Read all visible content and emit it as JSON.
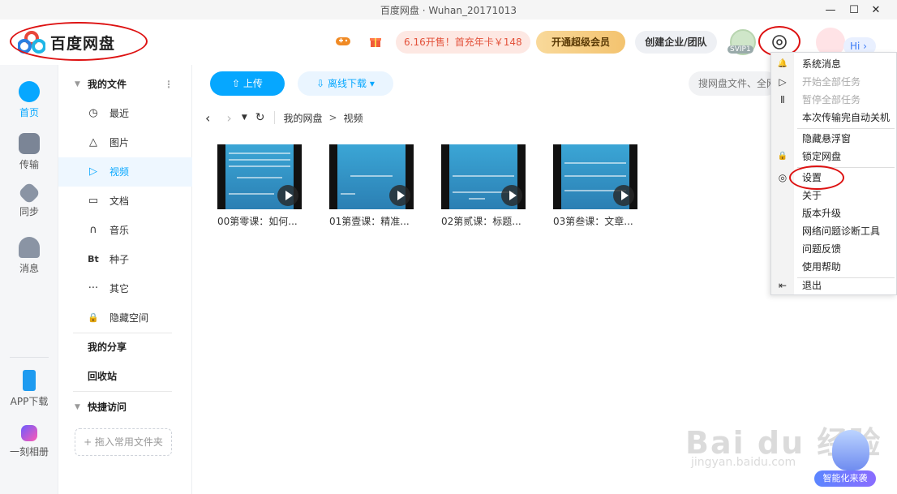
{
  "window": {
    "title": "百度网盘 · Wuhan_20171013",
    "controls": [
      "—",
      "☐",
      "✕"
    ]
  },
  "header": {
    "logo_text": "百度网盘",
    "promo": "6.16开售！首充年卡￥148",
    "vip_button": "开通超级会员",
    "team_button": "创建企业/团队",
    "svip_badge": "SVIP1",
    "hi_label": "Hi ›"
  },
  "rail": {
    "items": [
      {
        "label": "首页",
        "icon": "home-cloud-icon"
      },
      {
        "label": "传输",
        "icon": "transfer-icon"
      },
      {
        "label": "同步",
        "icon": "sync-icon"
      },
      {
        "label": "消息",
        "icon": "message-icon"
      },
      {
        "label": "APP下载",
        "icon": "phone-icon"
      },
      {
        "label": "一刻相册",
        "icon": "album-icon"
      }
    ]
  },
  "sidenav": {
    "my_files": "我的文件",
    "items": [
      {
        "label": "最近",
        "icon": "clock-icon",
        "glyph": "◷"
      },
      {
        "label": "图片",
        "icon": "picture-icon",
        "glyph": "△"
      },
      {
        "label": "视频",
        "icon": "video-icon",
        "glyph": "▷"
      },
      {
        "label": "文档",
        "icon": "document-icon",
        "glyph": "▭"
      },
      {
        "label": "音乐",
        "icon": "headphone-icon",
        "glyph": "∩"
      },
      {
        "label": "种子",
        "icon": "bt-icon",
        "glyph": "Bt"
      },
      {
        "label": "其它",
        "icon": "more-icon",
        "glyph": "···"
      },
      {
        "label": "隐藏空间",
        "icon": "lock-icon",
        "glyph": "🔒"
      }
    ],
    "my_share": "我的分享",
    "recycle": "回收站",
    "quick_access": "快捷访问",
    "drop_hint": "+ 拖入常用文件夹"
  },
  "main": {
    "upload_label": "上传",
    "offline_label": "离线下载",
    "search_placeholder": "搜网盘文件、全网",
    "breadcrumb": [
      "我的网盘",
      ">",
      "视频"
    ],
    "files": [
      {
        "name": "00第零课：如何..."
      },
      {
        "name": "01第壹课：精准..."
      },
      {
        "name": "02第贰课：标题..."
      },
      {
        "name": "03第叁课：文章..."
      }
    ]
  },
  "menu": {
    "items": [
      {
        "label": "系统消息",
        "icon": "bell-icon",
        "glyph": "🔔",
        "disabled": false
      },
      {
        "label": "开始全部任务",
        "icon": "play-icon",
        "glyph": "▷",
        "disabled": true
      },
      {
        "label": "暂停全部任务",
        "icon": "pause-icon",
        "glyph": "Ⅱ",
        "disabled": true
      },
      {
        "label": "本次传输完自动关机",
        "icon": "",
        "glyph": "",
        "disabled": false
      },
      {
        "label": "隐藏悬浮窗",
        "icon": "",
        "glyph": "",
        "disabled": false
      },
      {
        "label": "锁定网盘",
        "icon": "lock-icon",
        "glyph": "🔒",
        "disabled": false
      },
      {
        "label": "设置",
        "icon": "settings-icon",
        "glyph": "◎",
        "disabled": false
      },
      {
        "label": "关于",
        "icon": "",
        "glyph": "",
        "disabled": false
      },
      {
        "label": "版本升级",
        "icon": "",
        "glyph": "",
        "disabled": false
      },
      {
        "label": "网络问题诊断工具",
        "icon": "",
        "glyph": "",
        "disabled": false
      },
      {
        "label": "问题反馈",
        "icon": "",
        "glyph": "",
        "disabled": false
      },
      {
        "label": "使用帮助",
        "icon": "",
        "glyph": "",
        "disabled": false
      },
      {
        "label": "退出",
        "icon": "exit-icon",
        "glyph": "⇤",
        "disabled": false
      }
    ]
  },
  "watermark": {
    "main": "Bai du 经验",
    "sub": "jingyan.baidu.com"
  },
  "assistant_label": "智能化来袭",
  "colors": {
    "accent": "#06a7ff",
    "annotation_red": "#d11111",
    "vip_gold": "#f3c36f",
    "promo_red": "#e3523b"
  }
}
